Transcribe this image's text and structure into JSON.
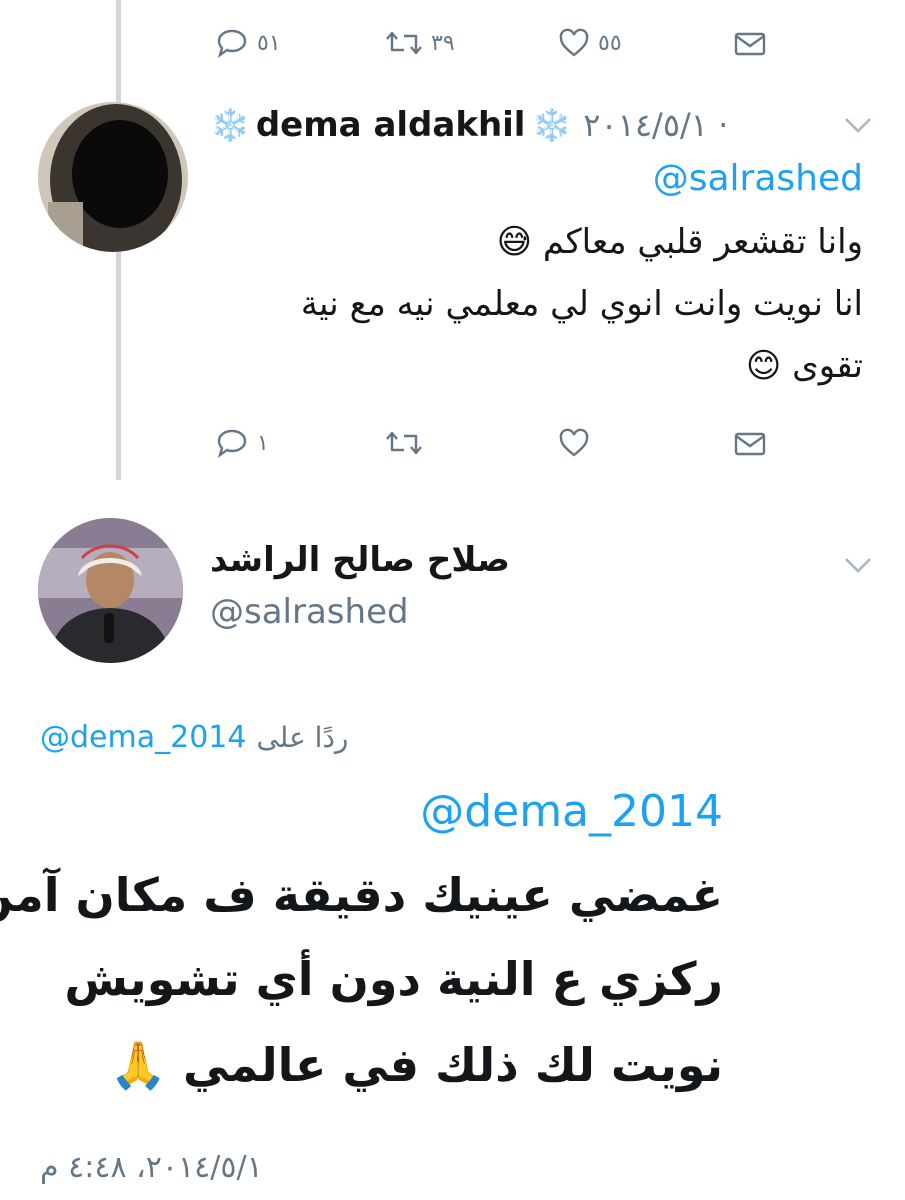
{
  "tweet1_actions": {
    "reply": "٥١",
    "retweet": "٣٩",
    "like": "٥٥"
  },
  "tweet2": {
    "name": "dema aldakhil",
    "name_emoji": "❄️",
    "date": "٢٠١٤/٥/١ ·",
    "reply_to": "@salrashed",
    "lines": [
      "وانا تقشعر قلبي معاكم 😅",
      "انا نويت وانت انوي لي معلمي نيه مع نية",
      "تقوى 😊"
    ],
    "actions": {
      "reply": "١"
    }
  },
  "tweet3": {
    "name": "صلاح صالح الراشد",
    "handle": "@salrashed",
    "replying_label": "ردًا على",
    "replying_handle": "@dema_2014",
    "mention": "@dema_2014",
    "lines": [
      "غمضي عينيك دقيقة ف مكان آمن",
      "ركزي ع النية دون أي تشويش",
      "نويت لك ذلك في عالمي 🙏"
    ],
    "timestamp": "٢٠١٤/٥/١، ٤:٤٨ م"
  },
  "colors": {
    "accent": "#1da1f2",
    "muted": "#657786",
    "thread_line": "#d0d6dc"
  }
}
